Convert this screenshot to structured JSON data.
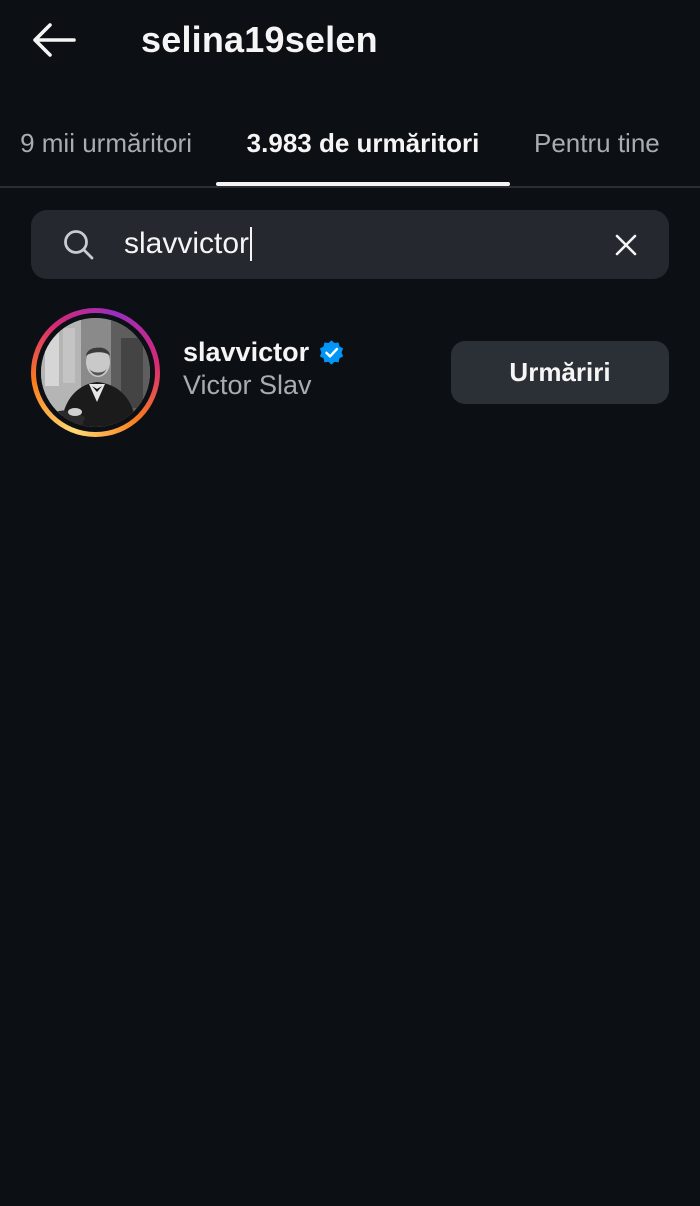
{
  "header": {
    "title": "selina19selen",
    "back_icon": "arrow-left-icon"
  },
  "tabs": [
    {
      "label": "9 mii urmăritori",
      "active": false
    },
    {
      "label": "3.983 de urmăritori",
      "active": true
    },
    {
      "label": "Pentru tine",
      "active": false
    }
  ],
  "search": {
    "value": "slavvictor",
    "search_icon": "search-icon",
    "clear_icon": "close-icon"
  },
  "results": [
    {
      "username": "slavvictor",
      "full_name": "Victor Slav",
      "verified": true,
      "button_label": "Urmăriri",
      "avatar_icon": "profile-photo"
    }
  ],
  "colors": {
    "background": "#0c0f14",
    "search_bg": "#25292f",
    "button_bg": "#2b3036",
    "verified_blue": "#0095f6",
    "secondary_text": "#a8acb3"
  }
}
